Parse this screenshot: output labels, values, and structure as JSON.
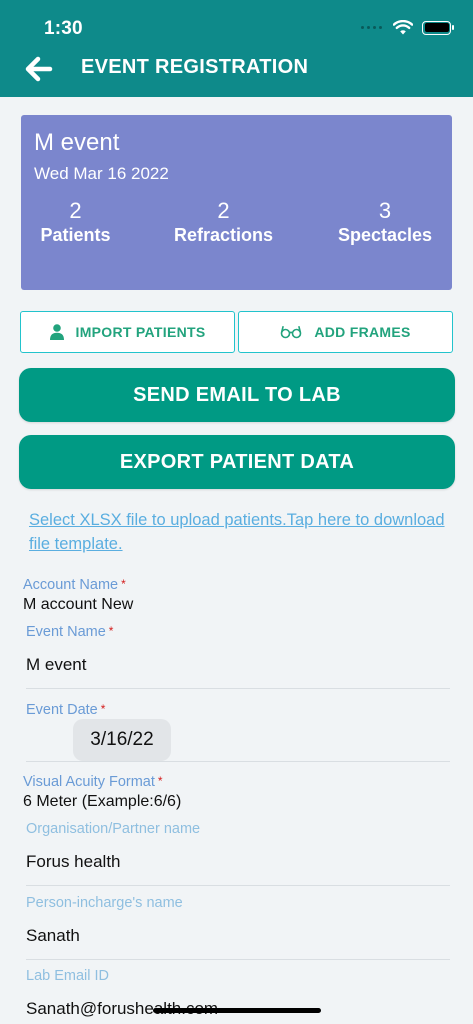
{
  "status_bar": {
    "time": "1:30"
  },
  "header": {
    "title": "EVENT REGISTRATION",
    "back_icon": "arrow-left-icon",
    "background": "#0e8a8a"
  },
  "summary": {
    "event_name": "M event",
    "event_date": "Wed Mar 16 2022",
    "stats": [
      {
        "value": "2",
        "label": "Patients"
      },
      {
        "value": "2",
        "label": "Refractions"
      },
      {
        "value": "3",
        "label": "Spectacles"
      }
    ],
    "background": "#7b86cd"
  },
  "actions": {
    "import_patients": "IMPORT PATIENTS",
    "add_frames": "ADD FRAMES",
    "send_email": "SEND EMAIL TO LAB",
    "export_data": "EXPORT PATIENT DATA",
    "accent": "#009a84"
  },
  "upload_link": "Select XLSX file to upload patients.Tap here to download file template.",
  "form": {
    "account_name_label": "Account Name",
    "account_name_value": "M account  New",
    "event_name_label": "Event Name",
    "event_name_value": "M event",
    "event_date_label": "Event Date",
    "event_date_value": "3/16/22",
    "visual_acuity_label": "Visual Acuity Format",
    "visual_acuity_value": "6 Meter (Example:6/6)",
    "organisation_label": "Organisation/Partner name",
    "organisation_value": "Forus health",
    "person_label": "Person-incharge's name",
    "person_value": "Sanath",
    "lab_email_label": "Lab Email ID",
    "lab_email_value": "Sanath@forushealth.com",
    "required_mark": "*"
  }
}
